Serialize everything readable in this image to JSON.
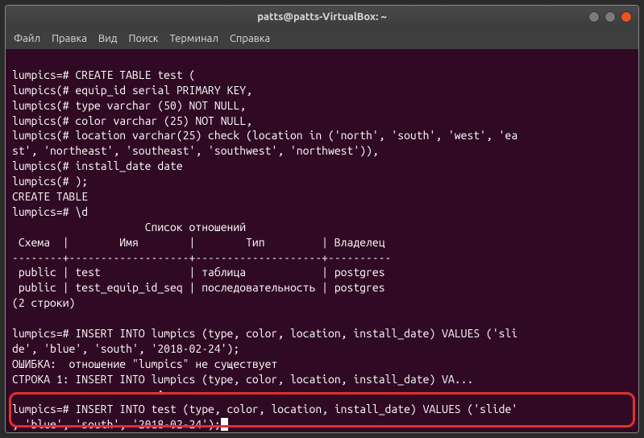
{
  "window": {
    "title": "patts@patts-VirtualBox: ~"
  },
  "menu": {
    "file": "Файл",
    "edit": "Правка",
    "view": "Вид",
    "search": "Поиск",
    "terminal": "Терминал",
    "help": "Справка"
  },
  "term": {
    "l01": "lumpics=# CREATE TABLE test (",
    "l02": "lumpics(# equip_id serial PRIMARY KEY,",
    "l03": "lumpics(# type varchar (50) NOT NULL,",
    "l04": "lumpics(# color varchar (25) NOT NULL,",
    "l05": "lumpics(# location varchar(25) check (location in ('north', 'south', 'west', 'ea",
    "l06": "st', 'northeast', 'southeast', 'southwest', 'northwest')),",
    "l07": "lumpics(# install_date date",
    "l08": "lumpics(# );",
    "l09": "CREATE TABLE",
    "l10": "lumpics=# \\d",
    "l11": "                     Список отношений",
    "l12": " Схема  |        Имя        |        Тип         | Владелец ",
    "l13": "--------+-------------------+--------------------+----------",
    "l14": " public | test              | таблица            | postgres",
    "l15": " public | test_equip_id_seq | последовательность | postgres",
    "l16": "(2 строки)",
    "l17": "",
    "l18": "lumpics=# INSERT INTO lumpics (type, color, location, install_date) VALUES ('sli",
    "l19": "de', 'blue', 'south', '2018-02-24');",
    "l20": "ОШИБКА:  отношение \"lumpics\" не существует",
    "l21": "СТРОКА 1: INSERT INTO lumpics (type, color, location, install_date) VA...",
    "l22": "                       ^",
    "l23": "lumpics=# INSERT INTO test (type, color, location, install_date) VALUES ('slide'",
    "l24": ", 'blue', 'south', '2018-02-24');"
  }
}
